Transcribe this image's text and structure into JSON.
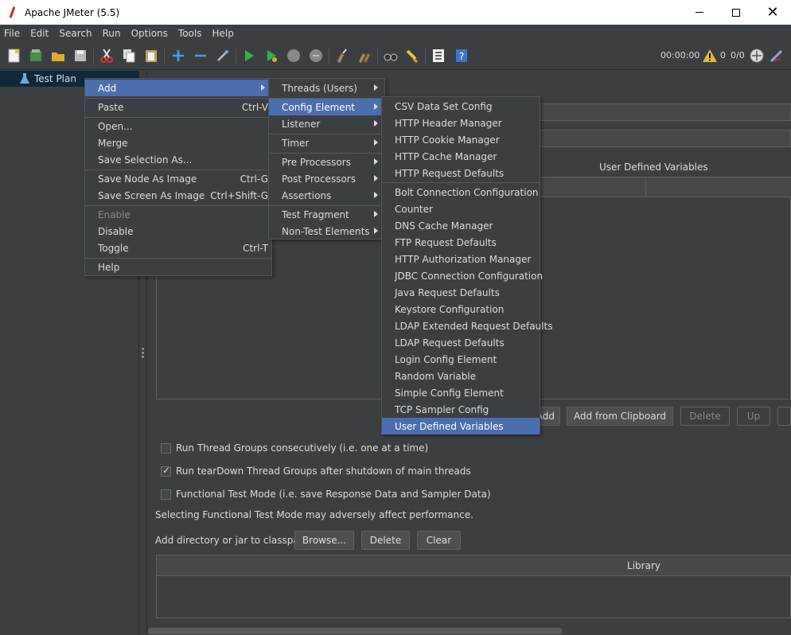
{
  "window": {
    "title": "Apache JMeter (5.5)"
  },
  "menubar": [
    "File",
    "Edit",
    "Search",
    "Run",
    "Options",
    "Tools",
    "Help"
  ],
  "toolbar": {
    "elapsed": "00:00:00",
    "warnings": "0",
    "threads": "0/0"
  },
  "tree": {
    "root": "Test Plan"
  },
  "main": {
    "udv_title": "User Defined Variables",
    "buttons": {
      "add": "Add",
      "add_clipboard": "Add from Clipboard",
      "delete": "Delete",
      "up": "Up"
    },
    "checks": [
      {
        "label": "Run Thread Groups consecutively (i.e. one at a time)",
        "checked": false
      },
      {
        "label": "Run tearDown Thread Groups after shutdown of main threads",
        "checked": true
      },
      {
        "label": "Functional Test Mode (i.e. save Response Data and Sampler Data)",
        "checked": false
      }
    ],
    "functional_note": "Selecting Functional Test Mode may adversely affect performance.",
    "classpath_label": "Add directory or jar to classpath",
    "classpath_buttons": {
      "browse": "Browse...",
      "delete": "Delete",
      "clear": "Clear"
    },
    "library_header": "Library"
  },
  "context_menu": {
    "add": "Add",
    "paste": "Paste",
    "paste_acc": "Ctrl-V",
    "open": "Open...",
    "merge": "Merge",
    "save_selection": "Save Selection As...",
    "save_node_image": "Save Node As Image",
    "save_node_acc": "Ctrl-G",
    "save_screen_image": "Save Screen As Image",
    "save_screen_acc": "Ctrl+Shift-G",
    "enable": "Enable",
    "disable": "Disable",
    "toggle": "Toggle",
    "toggle_acc": "Ctrl-T",
    "help": "Help"
  },
  "add_menu": {
    "threads": "Threads (Users)",
    "config": "Config Element",
    "listener": "Listener",
    "timer": "Timer",
    "pre": "Pre Processors",
    "post": "Post Processors",
    "assertions": "Assertions",
    "fragment": "Test Fragment",
    "nontest": "Non-Test Elements"
  },
  "config_menu": [
    "CSV Data Set Config",
    "HTTP Header Manager",
    "HTTP Cookie Manager",
    "HTTP Cache Manager",
    "HTTP Request Defaults",
    "Bolt Connection Configuration",
    "Counter",
    "DNS Cache Manager",
    "FTP Request Defaults",
    "HTTP Authorization Manager",
    "JDBC Connection Configuration",
    "Java Request Defaults",
    "Keystore Configuration",
    "LDAP Extended Request Defaults",
    "LDAP Request Defaults",
    "Login Config Element",
    "Random Variable",
    "Simple Config Element",
    "TCP Sampler Config",
    "User Defined Variables"
  ]
}
